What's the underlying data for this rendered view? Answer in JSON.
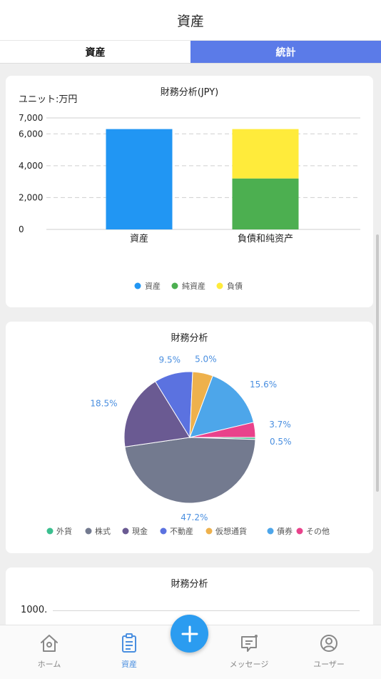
{
  "header": {
    "title": "資産"
  },
  "tabs": [
    {
      "label": "資産",
      "active": false
    },
    {
      "label": "統計",
      "active": true
    }
  ],
  "bar_card": {
    "title": "財務分析(JPY)",
    "unit": "ユニット:万円"
  },
  "pie_card": {
    "title": "財務分析"
  },
  "line_card": {
    "title": "財務分析",
    "y_top_label": "1000."
  },
  "chart_data": [
    {
      "type": "bar",
      "title": "財務分析(JPY)",
      "categories": [
        "資産",
        "負債和纯资产"
      ],
      "series": [
        {
          "name": "資産",
          "color": "#2196f3",
          "values": [
            6300,
            0
          ]
        },
        {
          "name": "純資産",
          "color": "#4caf50",
          "values": [
            0,
            3200
          ]
        },
        {
          "name": "負債",
          "color": "#ffeb3b",
          "values": [
            0,
            3100
          ]
        }
      ],
      "stacked": true,
      "yticks": [
        0,
        2000,
        4000,
        6000,
        7000
      ],
      "ytick_labels": [
        "0",
        "2,000",
        "4,000",
        "6,000",
        "7,000"
      ],
      "ylim": [
        0,
        7000
      ],
      "grid": true,
      "legend": "bottom"
    },
    {
      "type": "pie",
      "title": "財務分析",
      "slices": [
        {
          "name": "外貨",
          "value": 0.5,
          "label": "0.5%",
          "color": "#3bbf8f"
        },
        {
          "name": "株式",
          "value": 47.2,
          "label": "47.2%",
          "color": "#737a8f"
        },
        {
          "name": "現金",
          "value": 18.5,
          "label": "18.5%",
          "color": "#6a5a92"
        },
        {
          "name": "不動産",
          "value": 9.5,
          "label": "9.5%",
          "color": "#5b72e0"
        },
        {
          "name": "仮想通貨",
          "value": 5.0,
          "label": "5.0%",
          "color": "#eeb14c"
        },
        {
          "name": "債券",
          "value": 15.6,
          "label": "15.6%",
          "color": "#4da6ea"
        },
        {
          "name": "その他",
          "value": 3.7,
          "label": "3.7%",
          "color": "#e9428b"
        }
      ],
      "legend": "bottom"
    }
  ],
  "nav": [
    {
      "label": "ホーム",
      "icon": "home-icon",
      "active": false
    },
    {
      "label": "資産",
      "icon": "clipboard-icon",
      "active": true
    },
    {
      "label": "メッセージ",
      "icon": "message-icon",
      "active": false
    },
    {
      "label": "ユーザー",
      "icon": "user-icon",
      "active": false
    }
  ],
  "fab": {
    "icon": "plus-icon"
  }
}
